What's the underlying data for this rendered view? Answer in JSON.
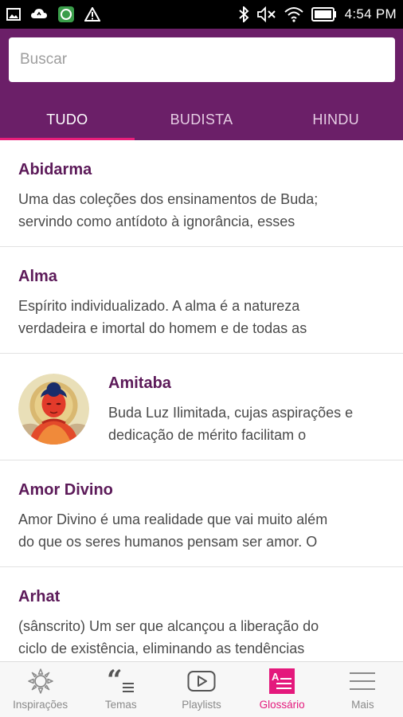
{
  "status_bar": {
    "time": "4:54 PM",
    "left_icons": [
      "image-icon",
      "cloud-icon",
      "app-notification-icon",
      "warning-icon"
    ],
    "right_icons": [
      "bluetooth-icon",
      "mute-icon",
      "wifi-icon",
      "battery-icon"
    ]
  },
  "search": {
    "placeholder": "Buscar",
    "value": ""
  },
  "tabs": [
    {
      "label": "TUDO",
      "active": true
    },
    {
      "label": "BUDISTA",
      "active": false
    },
    {
      "label": "HINDU",
      "active": false
    }
  ],
  "entries": [
    {
      "title": "Abidarma",
      "description": "Uma das coleções dos ensinamentos de Buda; servindo como antídoto à ignorância, esses",
      "line1": "Uma das coleções dos ensinamentos de Buda;",
      "line2": "servindo como antídoto à ignorância, esses"
    },
    {
      "title": "Alma",
      "description": "Espírito individualizado. A alma é a natureza verdadeira e imortal do homem e de todas as",
      "line1": "Espírito individualizado. A alma é a natureza",
      "line2": "verdadeira e imortal do homem e de todas as"
    },
    {
      "title": "Amitaba",
      "description": "Buda Luz Ilimitada, cujas aspirações e dedicação de mérito facilitam o",
      "line1": "Buda Luz Ilimitada, cujas aspirações e",
      "line2": "dedicação de mérito facilitam o",
      "thumbnail": "amitabha-buddha-image"
    },
    {
      "title": "Amor Divino",
      "description": "Amor Divino é uma realidade que vai muito além do que os seres humanos pensam ser amor. O",
      "line1": "Amor Divino é uma realidade que vai muito além",
      "line2": "do que os seres humanos pensam ser amor. O"
    },
    {
      "title": "Arhat",
      "description": "(sânscrito) Um ser que alcançou a liberação do ciclo de existência, eliminando as tendências",
      "line1": "(sânscrito) Um ser que alcançou a liberação do",
      "line2": "ciclo de existência, eliminando as tendências"
    }
  ],
  "bottom_nav": [
    {
      "label": "Inspirações",
      "icon": "sun-icon",
      "active": false
    },
    {
      "label": "Temas",
      "icon": "quote-icon",
      "active": false
    },
    {
      "label": "Playlists",
      "icon": "play-icon",
      "active": false
    },
    {
      "label": "Glossário",
      "icon": "glossary-icon",
      "active": true
    },
    {
      "label": "Mais",
      "icon": "menu-icon",
      "active": false
    }
  ],
  "colors": {
    "header": "#6b1f68",
    "accent": "#e91e7a",
    "title": "#5c1a59"
  }
}
